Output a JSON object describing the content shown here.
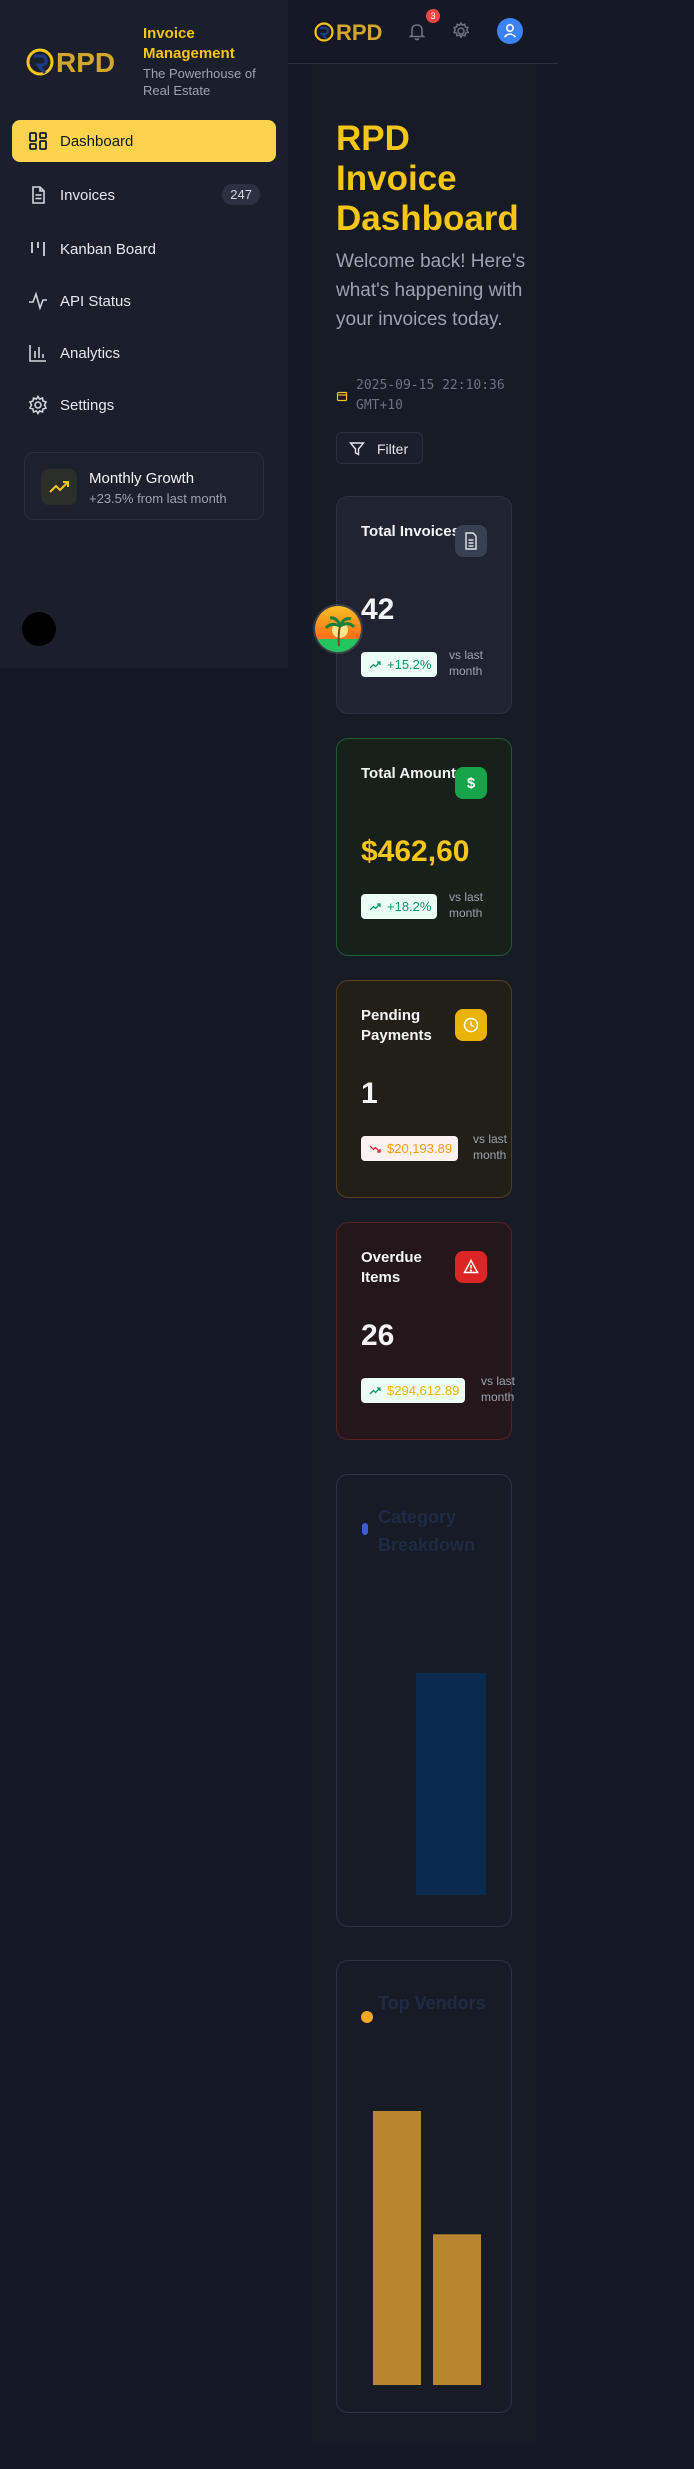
{
  "brand": {
    "logo_text": "RPD",
    "title": "Invoice Management",
    "subtitle": "The Powerhouse of Real Estate"
  },
  "sidebar": {
    "items": [
      {
        "label": "Dashboard",
        "icon": "dashboard-grid-icon",
        "active": true
      },
      {
        "label": "Invoices",
        "icon": "document-icon",
        "count": "247"
      },
      {
        "label": "Kanban Board",
        "icon": "kanban-icon"
      },
      {
        "label": "API Status",
        "icon": "activity-icon"
      },
      {
        "label": "Analytics",
        "icon": "bar-chart-icon"
      },
      {
        "label": "Settings",
        "icon": "gear-icon"
      }
    ],
    "growth": {
      "title": "Monthly Growth",
      "subtitle": "+23.5% from last month",
      "icon": "trending-up-icon"
    }
  },
  "topbar": {
    "logo_text": "RPD",
    "notification_count": "3"
  },
  "main": {
    "title": "RPD Invoice Dashboard",
    "welcome": "Welcome back! Here's what's happening with your invoices today.",
    "timestamp": "2025-09-15 22:10:36 GMT+10",
    "filter_label": "Filter"
  },
  "stats": [
    {
      "title": "Total Invoices",
      "value": "42",
      "change": "+15.2%",
      "vs": "vs last month",
      "icon": "document-icon",
      "trend": "up"
    },
    {
      "title": "Total Amount",
      "value": "$462,60",
      "change": "+18.2%",
      "vs": "vs last month",
      "icon": "dollar-icon",
      "trend": "up"
    },
    {
      "title": "Pending Payments",
      "value": "1",
      "change": "$20,193.89",
      "vs": "vs last month",
      "icon": "clock-icon",
      "trend": "down"
    },
    {
      "title": "Overdue Items",
      "value": "26",
      "change": "$294,612.89",
      "vs": "vs last month",
      "icon": "warning-icon",
      "trend": "up"
    }
  ],
  "colors": {
    "accent": "#f5c518",
    "background": "#141925",
    "blue_bar": "#0b2a4f",
    "amber_bar": "#b7862e"
  },
  "chart_data": [
    {
      "type": "bar",
      "title": "Category Breakdown",
      "categories": [
        ""
      ],
      "values": [
        1
      ]
    },
    {
      "type": "bar",
      "title": "Top Vendors",
      "categories": [
        "",
        ""
      ],
      "values": [
        1,
        0.55
      ]
    }
  ]
}
